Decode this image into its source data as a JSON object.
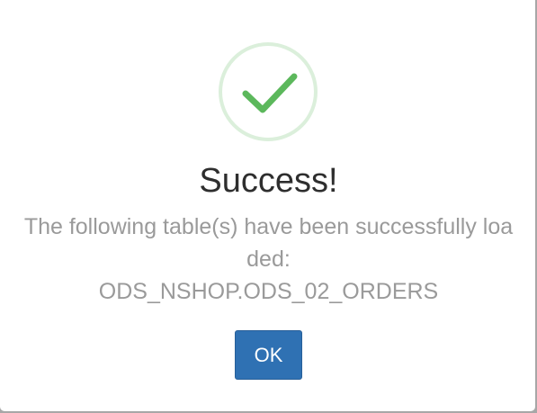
{
  "dialog": {
    "icon": "success-check-icon",
    "title": "Success!",
    "message": "The following table(s) have been successfully loaded:",
    "table_name": "ODS_NSHOP.ODS_02_ORDERS",
    "ok_label": "OK"
  },
  "colors": {
    "success": "#5cb85c",
    "primary_button": "#2f71b3",
    "title_text": "#2e2e2e",
    "message_text": "#9a9a9a"
  }
}
